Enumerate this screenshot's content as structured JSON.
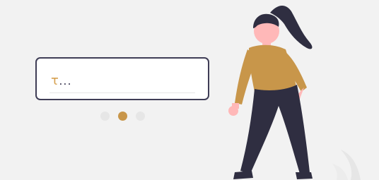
{
  "input": {
    "value_main": "τ",
    "value_ellipsis": "..."
  },
  "pager": {
    "count": 3,
    "active_index": 1
  },
  "colors": {
    "background": "#f2f2f2",
    "card_border": "#3f3d56",
    "accent": "#c8964a",
    "dot_inactive": "#e6e6e6",
    "hair": "#2f2e41",
    "skin": "#ffb8b8",
    "pants": "#2f2e41"
  },
  "icons": {
    "person": "person-illustration-icon"
  }
}
